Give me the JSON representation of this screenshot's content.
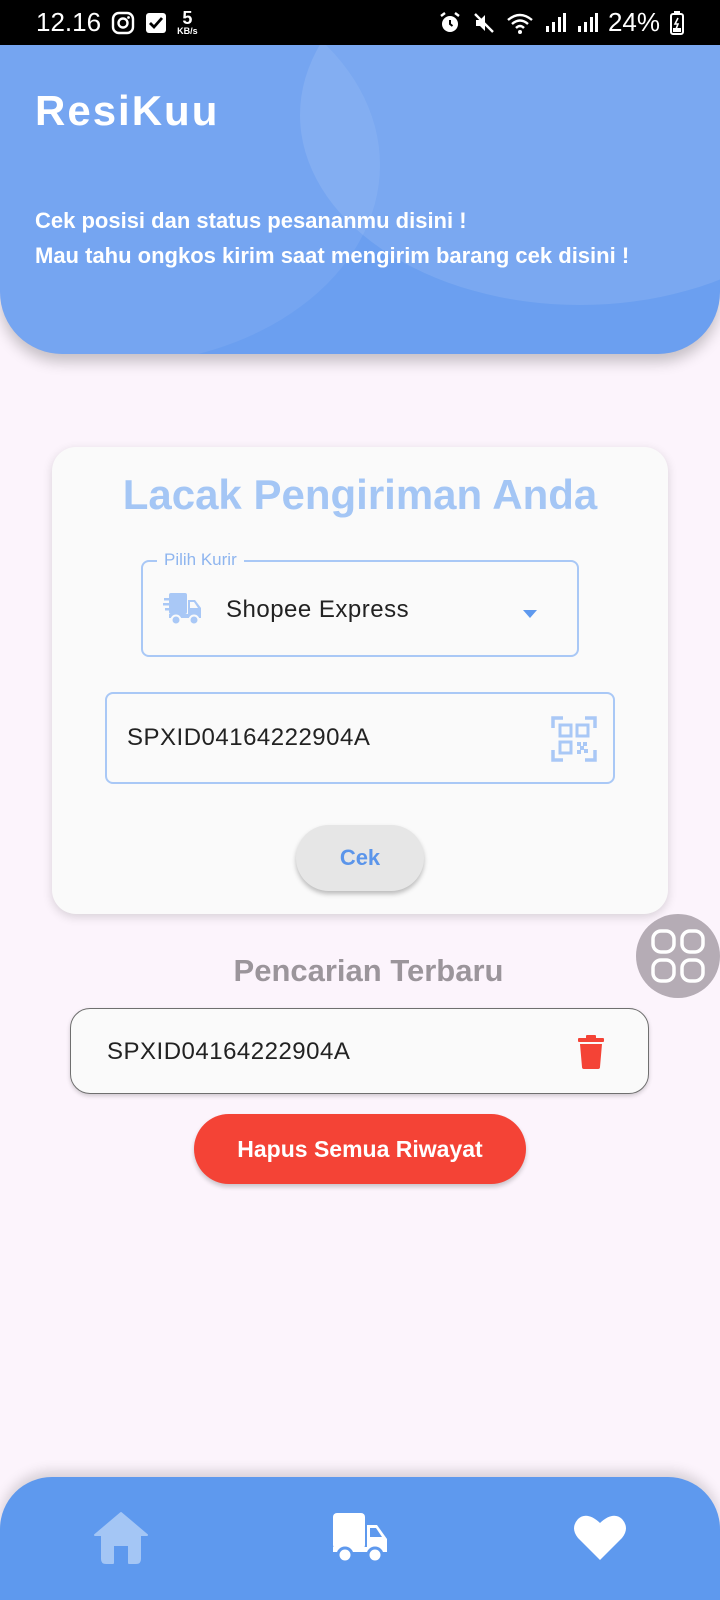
{
  "status_bar": {
    "time": "12.16",
    "speed_value": "5",
    "speed_unit": "KB/s",
    "battery": "24%"
  },
  "header": {
    "title": "ResiKuu",
    "tagline_line1": "Cek posisi dan status pesananmu disini !",
    "tagline_line2": "Mau tahu ongkos kirim saat mengirim barang  cek disini !"
  },
  "track_card": {
    "title": "Lacak Pengiriman Anda",
    "courier_label": "Pilih Kurir",
    "courier_value": "Shopee Express",
    "tracking_number": "SPXID04164222904A",
    "check_button": "Cek"
  },
  "recent": {
    "title": "Pencarian Terbaru",
    "items": [
      {
        "tracking_number": "SPXID04164222904A"
      }
    ],
    "clear_button": "Hapus Semua Riwayat"
  },
  "colors": {
    "primary": "#5e99ee",
    "header": "#6b9ff0",
    "title_light": "#a4c6f5",
    "danger": "#f44336",
    "background": "#fcf4fc"
  },
  "icons": {
    "status_left": [
      "instagram-icon",
      "checkbox-icon"
    ],
    "status_right": [
      "alarm-icon",
      "mute-icon",
      "wifi-icon",
      "signal-icon",
      "signal-icon",
      "battery-icon"
    ],
    "nav": [
      "home-icon",
      "truck-icon",
      "heart-icon"
    ]
  }
}
